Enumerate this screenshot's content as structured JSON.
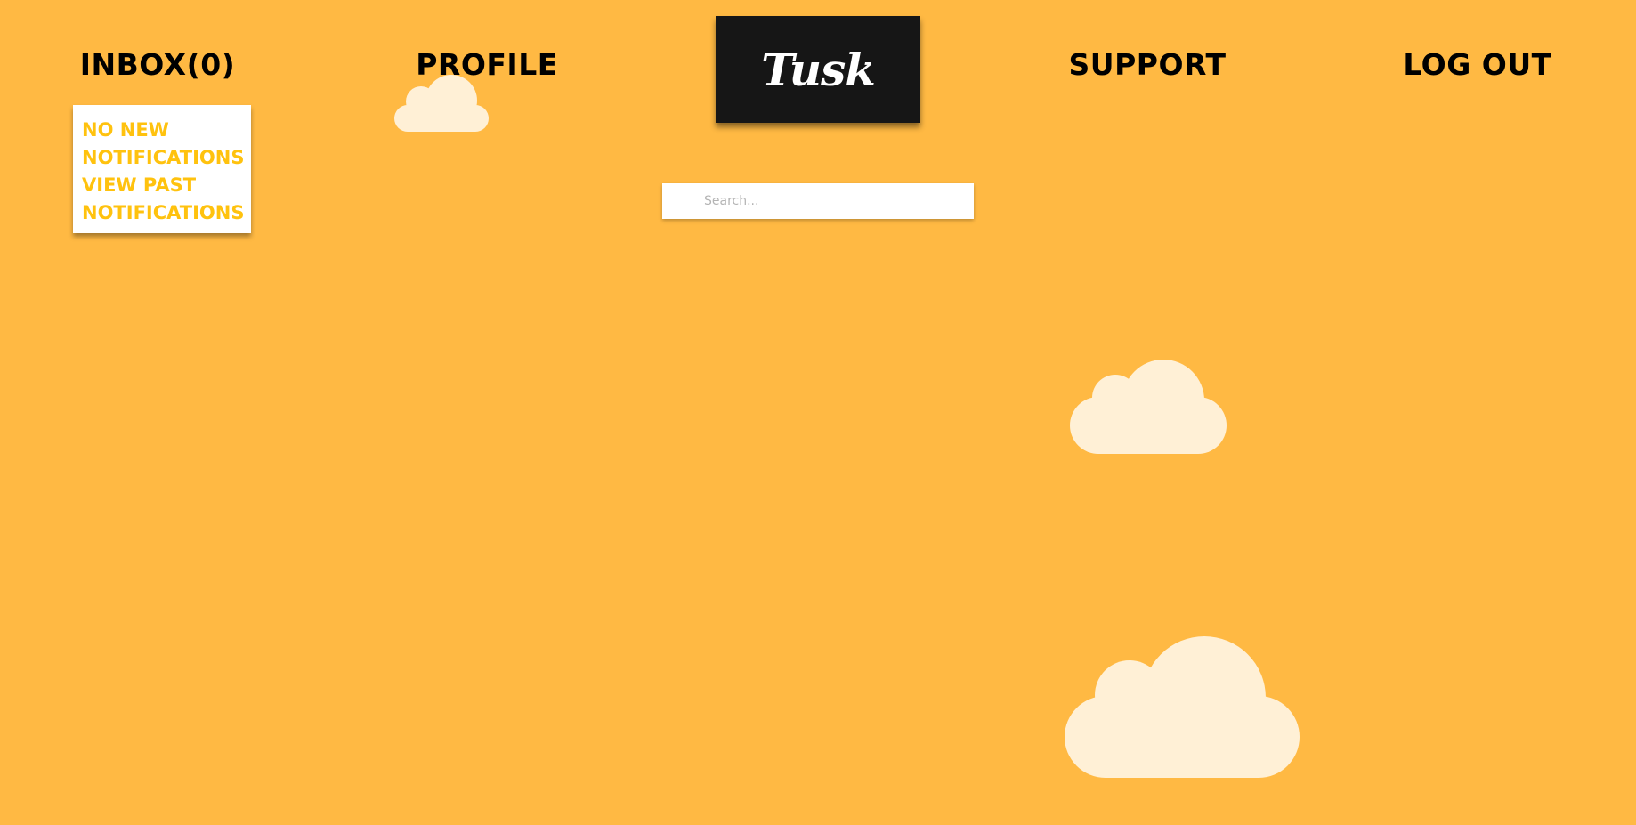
{
  "nav": {
    "inbox": "INBOX(0)",
    "profile": "PROFILE",
    "support": "SUPPORT",
    "logout": "LOG OUT"
  },
  "logo": {
    "text": "Tusk"
  },
  "search": {
    "placeholder": "Search...",
    "value": ""
  },
  "notifications_dropdown": {
    "items": [
      "NO NEW NOTIFICATIONS",
      "VIEW PAST NOTIFICATIONS"
    ]
  },
  "colors": {
    "background": "#FFB943",
    "logo_background": "#161616",
    "dropdown_text": "#FFC20E",
    "cloud": "#FFF0D6"
  },
  "decorations": [
    "cloud-icon",
    "cloud-icon",
    "cloud-icon"
  ]
}
